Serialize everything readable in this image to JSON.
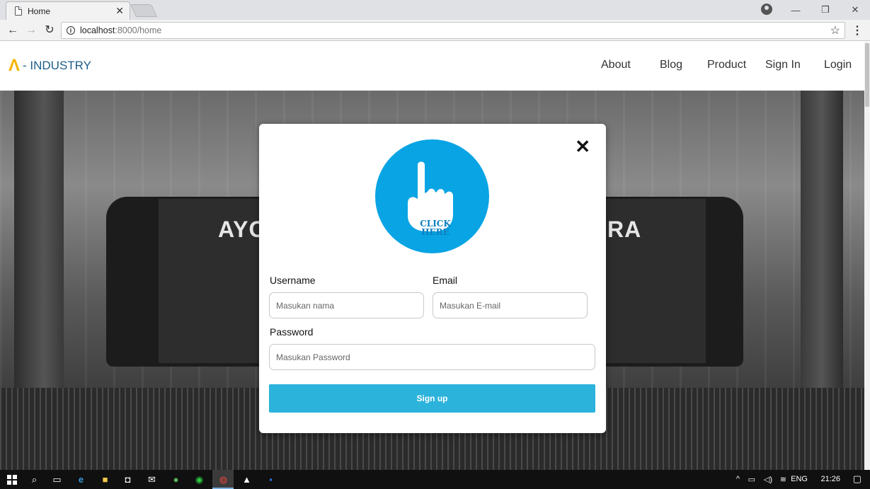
{
  "browser": {
    "tab_title": "Home",
    "url_host": "localhost",
    "url_rest": ":8000/home"
  },
  "site": {
    "logo_mark": "Λ",
    "logo_text": "- INDUSTRY",
    "nav": [
      "About",
      "Blog",
      "Product",
      "Sign In",
      "Login"
    ]
  },
  "hero": {
    "title_left_fragment": "AYO",
    "title_right_fragment": "RA"
  },
  "modal": {
    "close_glyph": "✕",
    "click_label_1": "CLICK",
    "click_label_2": "HERE",
    "username_label": "Username",
    "username_placeholder": "Masukan nama",
    "email_label": "Email",
    "email_placeholder": "Masukan E-mail",
    "password_label": "Password",
    "password_placeholder": "Masukan Password",
    "submit_label": "Sign up"
  },
  "taskbar": {
    "language": "ENG",
    "time": "21:26"
  },
  "colors": {
    "brand_blue": "#1b5d8c",
    "brand_yellow": "#f5b400",
    "click_circle": "#08a4e4",
    "button": "#2bb3dc"
  },
  "icons": [
    "doc-icon",
    "close-icon",
    "back-icon",
    "forward-icon",
    "reload-icon",
    "info-icon",
    "star-icon",
    "menu-icon",
    "account-icon",
    "pointing-hand-icon",
    "windows-icon",
    "search-icon",
    "task-view-icon",
    "edge-icon",
    "explorer-icon",
    "store-icon",
    "mail-icon",
    "chrome-icon",
    "photos-icon",
    "notification-icon"
  ]
}
